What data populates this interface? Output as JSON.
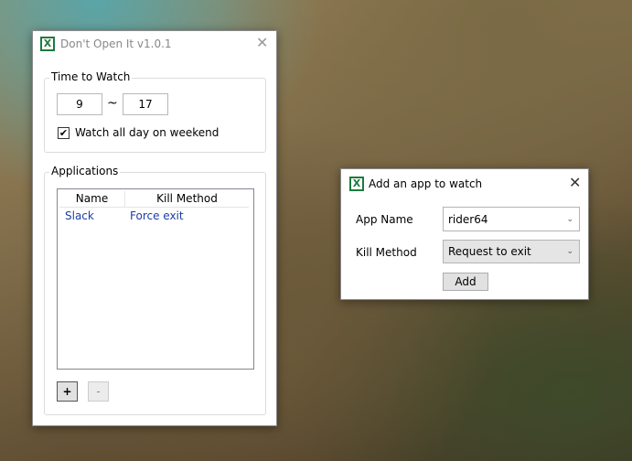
{
  "main_window": {
    "title": "Don't Open It v1.0.1",
    "time_group": {
      "label": "Time to Watch",
      "start": "9",
      "separator": "~",
      "end": "17",
      "weekend_label": "Watch all day on weekend",
      "weekend_checked": true
    },
    "apps_group": {
      "label": "Applications",
      "columns": [
        "Name",
        "Kill Method"
      ],
      "rows": [
        {
          "name": "Slack",
          "method": "Force exit"
        }
      ],
      "add_label": "+",
      "remove_label": "-"
    }
  },
  "dialog": {
    "title": "Add an app to watch",
    "app_name_label": "App Name",
    "app_name_value": "rider64",
    "kill_method_label": "Kill Method",
    "kill_method_value": "Request to exit",
    "add_label": "Add"
  }
}
